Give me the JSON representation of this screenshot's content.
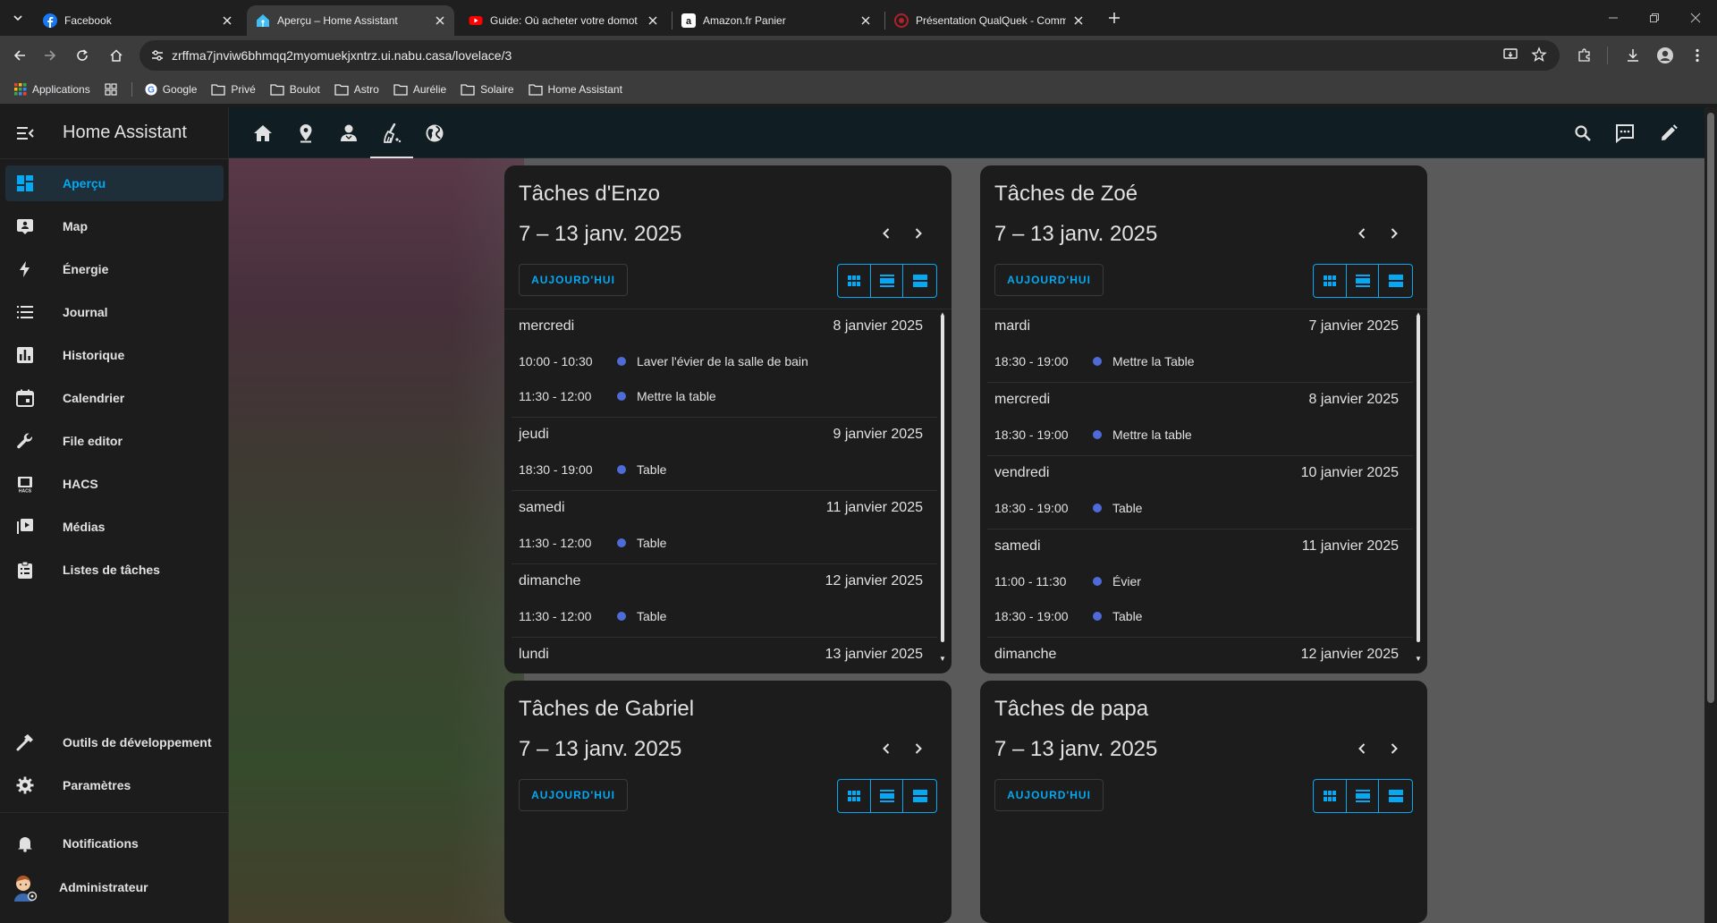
{
  "browser": {
    "tabs": [
      {
        "title": "Facebook",
        "icon": "facebook-icon",
        "color": "#1877f2",
        "active": false
      },
      {
        "title": "Aperçu – Home Assistant",
        "icon": "home-assistant-icon",
        "color": "#41bdf5",
        "active": true
      },
      {
        "title": "Guide: Où acheter votre domot",
        "icon": "youtube-icon",
        "color": "#ff0000",
        "active": false
      },
      {
        "title": "Amazon.fr Panier",
        "icon": "amazon-icon",
        "color": "#ffffff",
        "active": false
      },
      {
        "title": "Présentation QualQuek - Comm",
        "icon": "forum-icon",
        "color": "#b3202a",
        "active": false
      }
    ],
    "url": "zrffma7jnviw6bhmqq2myomuekjxntrz.ui.nabu.casa/lovelace/3",
    "bookmarks": [
      {
        "label": "Applications",
        "icon": "apps-grid-icon"
      },
      {
        "label": "Google",
        "icon": "google-icon"
      },
      {
        "label": "Privé",
        "icon": "folder-icon"
      },
      {
        "label": "Boulot",
        "icon": "folder-icon"
      },
      {
        "label": "Astro",
        "icon": "folder-icon"
      },
      {
        "label": "Aurélie",
        "icon": "folder-icon"
      },
      {
        "label": "Solaire",
        "icon": "folder-icon"
      },
      {
        "label": "Home Assistant",
        "icon": "folder-icon"
      }
    ]
  },
  "sidebar": {
    "title": "Home Assistant",
    "items": [
      {
        "label": "Aperçu",
        "icon": "dashboard-icon",
        "active": true
      },
      {
        "label": "Map",
        "icon": "map-icon"
      },
      {
        "label": "Énergie",
        "icon": "lightning-icon"
      },
      {
        "label": "Journal",
        "icon": "list-icon"
      },
      {
        "label": "Historique",
        "icon": "chart-box-icon"
      },
      {
        "label": "Calendrier",
        "icon": "calendar-icon"
      },
      {
        "label": "File editor",
        "icon": "wrench-icon"
      },
      {
        "label": "HACS",
        "icon": "hacs-icon"
      },
      {
        "label": "Médias",
        "icon": "play-box-icon"
      },
      {
        "label": "Listes de tâches",
        "icon": "clipboard-list-icon"
      }
    ],
    "bottom": [
      {
        "label": "Outils de développement",
        "icon": "hammer-icon"
      },
      {
        "label": "Paramètres",
        "icon": "cog-icon"
      }
    ],
    "notifications": {
      "label": "Notifications",
      "icon": "bell-icon"
    },
    "user": {
      "label": "Administrateur",
      "icon": "avatar-icon"
    }
  },
  "toolbar": {
    "views": [
      "home-icon",
      "map-marker-icon",
      "account-icon",
      "broom-icon",
      "earth-icon"
    ],
    "active_view": 3,
    "actions": [
      "search-icon",
      "assist-icon",
      "pencil-icon"
    ]
  },
  "colors": {
    "accent": "#03a9f4",
    "event_dot": "#4e6bd8"
  },
  "calendars": [
    {
      "title": "Tâches d'Enzo",
      "range": "7 – 13 janv. 2025",
      "today_label": "AUJOURD'HUI",
      "days": [
        {
          "weekday": "mercredi",
          "date": "8 janvier 2025",
          "events": [
            {
              "time": "10:00 - 10:30",
              "title": "Laver l'évier de la salle de bain"
            },
            {
              "time": "11:30 - 12:00",
              "title": "Mettre la table"
            }
          ]
        },
        {
          "weekday": "jeudi",
          "date": "9 janvier 2025",
          "events": [
            {
              "time": "18:30 - 19:00",
              "title": "Table"
            }
          ]
        },
        {
          "weekday": "samedi",
          "date": "11 janvier 2025",
          "events": [
            {
              "time": "11:30 - 12:00",
              "title": "Table"
            }
          ]
        },
        {
          "weekday": "dimanche",
          "date": "12 janvier 2025",
          "events": [
            {
              "time": "11:30 - 12:00",
              "title": "Table"
            }
          ]
        },
        {
          "weekday": "lundi",
          "date": "13 janvier 2025",
          "events": []
        }
      ]
    },
    {
      "title": "Tâches de Zoé",
      "range": "7 – 13 janv. 2025",
      "today_label": "AUJOURD'HUI",
      "days": [
        {
          "weekday": "mardi",
          "date": "7 janvier 2025",
          "events": [
            {
              "time": "18:30 - 19:00",
              "title": "Mettre la Table"
            }
          ]
        },
        {
          "weekday": "mercredi",
          "date": "8 janvier 2025",
          "events": [
            {
              "time": "18:30 - 19:00",
              "title": "Mettre la table"
            }
          ]
        },
        {
          "weekday": "vendredi",
          "date": "10 janvier 2025",
          "events": [
            {
              "time": "18:30 - 19:00",
              "title": "Table"
            }
          ]
        },
        {
          "weekday": "samedi",
          "date": "11 janvier 2025",
          "events": [
            {
              "time": "11:00 - 11:30",
              "title": "Évier"
            },
            {
              "time": "18:30 - 19:00",
              "title": "Table"
            }
          ]
        },
        {
          "weekday": "dimanche",
          "date": "12 janvier 2025",
          "events": []
        }
      ]
    },
    {
      "title": "Tâches de Gabriel",
      "range": "7 – 13 janv. 2025",
      "today_label": "AUJOURD'HUI",
      "days": []
    },
    {
      "title": "Tâches de papa",
      "range": "7 – 13 janv. 2025",
      "today_label": "AUJOURD'HUI",
      "days": []
    }
  ]
}
